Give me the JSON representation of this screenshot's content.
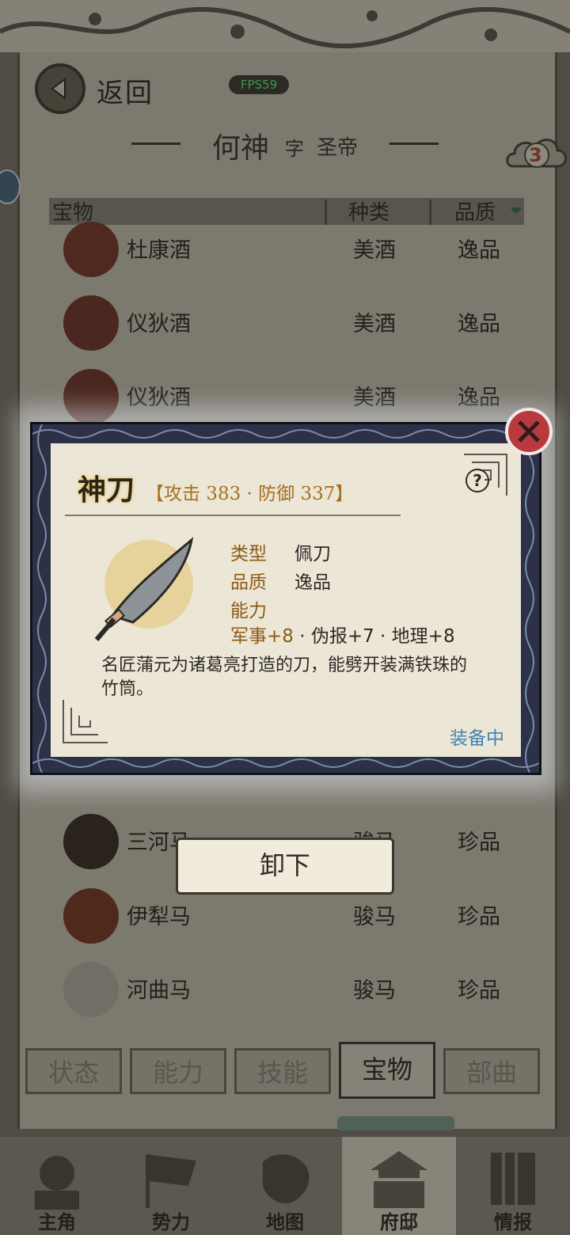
{
  "header": {
    "back_label": "返回",
    "fps": "FPS59",
    "hero_name": "何神",
    "zi_label": "字",
    "hero_title": "圣帝",
    "cloud_badge": "3"
  },
  "table": {
    "col_item": "宝物",
    "col_type": "种类",
    "col_quality": "品质"
  },
  "rows": [
    {
      "name": "杜康酒",
      "type": "美酒",
      "quality": "逸品",
      "icon": "wine-jar-icon"
    },
    {
      "name": "仪狄酒",
      "type": "美酒",
      "quality": "逸品",
      "icon": "wine-jar-icon"
    },
    {
      "name": "仪狄酒",
      "type": "美酒",
      "quality": "逸品",
      "icon": "wine-jar-icon"
    },
    {
      "name": "三河马",
      "type": "骏马",
      "quality": "珍品",
      "icon": "horse-icon"
    },
    {
      "name": "伊犁马",
      "type": "骏马",
      "quality": "珍品",
      "icon": "horse-icon"
    },
    {
      "name": "河曲马",
      "type": "骏马",
      "quality": "珍品",
      "icon": "horse-icon"
    }
  ],
  "modal": {
    "title": "神刀",
    "stats": "【攻击 383 · 防御 337】",
    "type_label": "类型",
    "type_value": "佩刀",
    "quality_label": "品质",
    "quality_value": "逸品",
    "ability_label": "能力",
    "ability_first": "军事+8",
    "ability_rest": " · 伪报+7 · 地理+8",
    "description": "名匠蒲元为诸葛亮打造的刀，能劈开装满铁珠的竹筒。",
    "status": "装备中",
    "help": "?"
  },
  "unequip_label": "卸下",
  "tabs": [
    "状态",
    "能力",
    "技能",
    "宝物",
    "部曲"
  ],
  "active_tab": "宝物",
  "nav": [
    {
      "label": "主角",
      "icon": "hero-icon"
    },
    {
      "label": "势力",
      "icon": "flag-icon"
    },
    {
      "label": "地图",
      "icon": "map-icon"
    },
    {
      "label": "府邸",
      "icon": "mansion-icon"
    },
    {
      "label": "情报",
      "icon": "scroll-icon"
    }
  ],
  "colors": {
    "stat_gold": "#a5701d",
    "label_brown": "#8b5a14",
    "equipped_blue": "#3e84b3",
    "close_red": "#b83a3c",
    "fps_green": "#5ef07e"
  }
}
